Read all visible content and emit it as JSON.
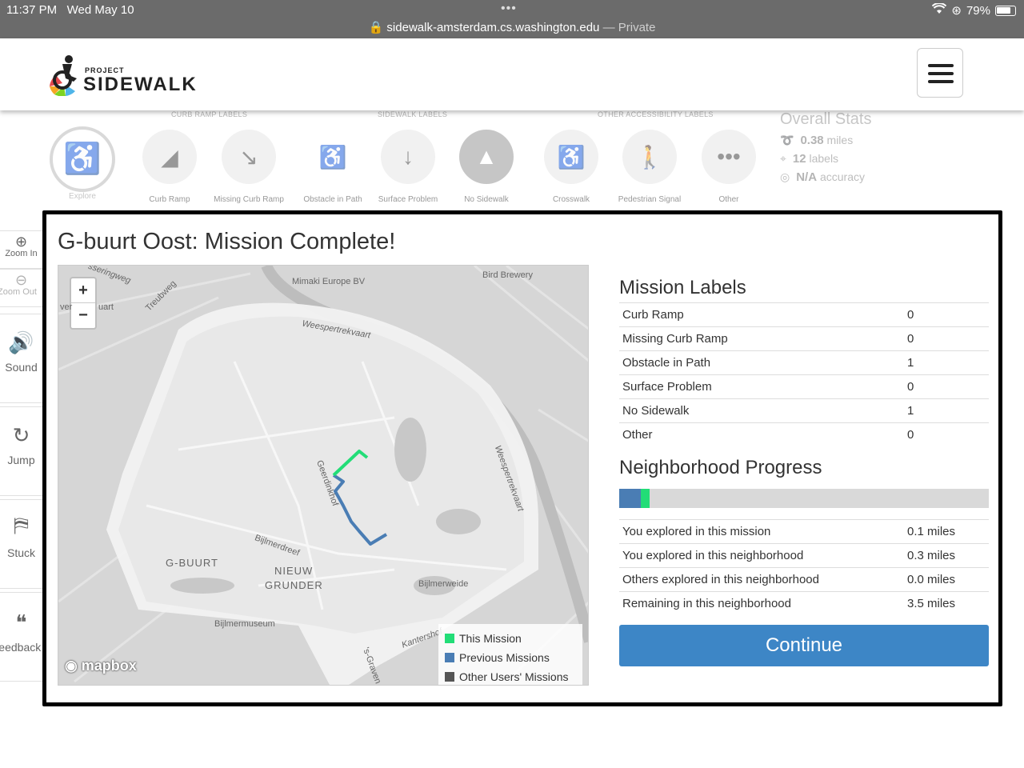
{
  "status_bar": {
    "time": "11:37 PM",
    "date": "Wed May 10",
    "dots": "•••",
    "url": "sidewalk-amsterdam.cs.washington.edu",
    "private_label": "— Private",
    "battery": "79%"
  },
  "header": {
    "logo_small": "PROJECT",
    "logo_big": "SIDEWALK"
  },
  "toolbar": {
    "groups": [
      "CURB RAMP LABELS",
      "SIDEWALK LABELS",
      "OTHER ACCESSIBILITY LABELS"
    ],
    "explore_label": "Explore",
    "tools": [
      {
        "label": "Curb Ramp",
        "icon": "curb-ramp-icon"
      },
      {
        "label": "Missing Curb Ramp",
        "icon": "missing-curb-ramp-icon"
      },
      {
        "label": "Obstacle in Path",
        "icon": "obstacle-icon"
      },
      {
        "label": "Surface Problem",
        "icon": "surface-problem-icon"
      },
      {
        "label": "No Sidewalk",
        "icon": "no-sidewalk-icon"
      },
      {
        "label": "Crosswalk",
        "icon": "crosswalk-icon"
      },
      {
        "label": "Pedestrian Signal",
        "icon": "pedestrian-signal-icon"
      },
      {
        "label": "Other",
        "icon": "more-icon"
      }
    ],
    "stats": {
      "title": "Overall Stats",
      "miles_value": "0.38",
      "miles_unit": "miles",
      "labels_value": "12",
      "labels_unit": "labels",
      "accuracy_value": "N/A",
      "accuracy_unit": "accuracy"
    }
  },
  "side_controls": {
    "zoom_in": "Zoom In",
    "zoom_out": "Zoom Out",
    "sound": "Sound",
    "jump": "Jump",
    "stuck": "Stuck",
    "feedback": "Feedback"
  },
  "modal": {
    "title": "G-buurt Oost: Mission Complete!",
    "map": {
      "zoom_in": "+",
      "zoom_out": "−",
      "labels": {
        "mimaki": "Mimaki Europe BV",
        "bird": "Bird Brewery",
        "weesper1": "Weespertrekvaart",
        "weesper2": "Weespertrekvaart",
        "geerdink": "Geerdinkhof",
        "bijlmerdreef": "Bijlmerdreef",
        "gbuurt": "G-BUURT",
        "nieuw": "NIEUW",
        "grunder": "GRUNDER",
        "bijlmerweide": "Bijlmerweide",
        "museum": "Bijlmermuseum",
        "treubweg": "Treubweg",
        "sseringweg": "sseringweg",
        "kantershof": "Kantershof",
        "sgraven": "'s-Graven",
        "uart": "uart",
        "ver": "ver"
      },
      "legend": [
        {
          "label": "This Mission",
          "color": "#22dd77"
        },
        {
          "label": "Previous Missions",
          "color": "#4a7db4"
        },
        {
          "label": "Other Users' Missions",
          "color": "#555555"
        }
      ],
      "attribution": "mapbox"
    },
    "mission_labels": {
      "title": "Mission Labels",
      "rows": [
        {
          "label": "Curb Ramp",
          "value": "0"
        },
        {
          "label": "Missing Curb Ramp",
          "value": "0"
        },
        {
          "label": "Obstacle in Path",
          "value": "1"
        },
        {
          "label": "Surface Problem",
          "value": "0"
        },
        {
          "label": "No Sidewalk",
          "value": "1"
        },
        {
          "label": "Other",
          "value": "0"
        }
      ]
    },
    "neighborhood_progress": {
      "title": "Neighborhood Progress",
      "previous_fraction": 0.058,
      "mission_fraction": 0.025,
      "rows": [
        {
          "label": "You explored in this mission",
          "value": "0.1 miles"
        },
        {
          "label": "You explored in this neighborhood",
          "value": "0.3 miles"
        },
        {
          "label": "Others explored in this neighborhood",
          "value": "0.0 miles"
        },
        {
          "label": "Remaining in this neighborhood",
          "value": "3.5 miles"
        }
      ]
    },
    "continue_label": "Continue"
  }
}
